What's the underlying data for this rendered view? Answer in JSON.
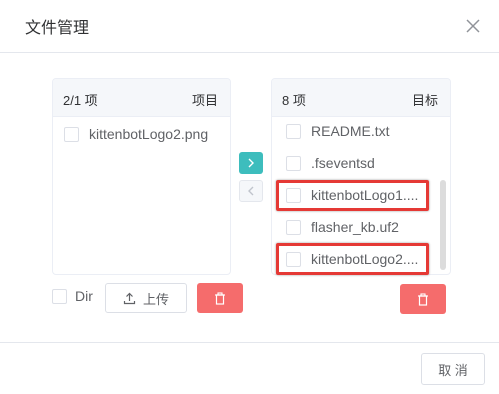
{
  "dialog": {
    "title": "文件管理",
    "close_icon": "close-icon"
  },
  "source_panel": {
    "count": "2/1 项",
    "title": "项目",
    "items": [
      {
        "label": "kittenbotLogo2.png",
        "checked": false
      }
    ]
  },
  "target_panel": {
    "count": "8 项",
    "title": "目标",
    "items": [
      {
        "label": "README.txt",
        "checked": false,
        "highlighted": false
      },
      {
        "label": ".fseventsd",
        "checked": false,
        "highlighted": false
      },
      {
        "label": "kittenbotLogo1....",
        "checked": false,
        "highlighted": true
      },
      {
        "label": "flasher_kb.uf2",
        "checked": false,
        "highlighted": false
      },
      {
        "label": "kittenbotLogo2....",
        "checked": false,
        "highlighted": true
      }
    ]
  },
  "transfer": {
    "right_icon": "chevron-right-icon",
    "left_icon": "chevron-left-icon"
  },
  "footer_left": {
    "dir_label": "Dir",
    "upload_label": "上传",
    "upload_icon": "upload-icon",
    "delete_icon": "trash-icon"
  },
  "footer_right": {
    "delete_icon": "trash-icon"
  },
  "dialog_footer": {
    "cancel_label": "取 消"
  },
  "colors": {
    "accent": "#3dbdbd",
    "danger": "#f56c6c",
    "highlight": "#e53935"
  }
}
